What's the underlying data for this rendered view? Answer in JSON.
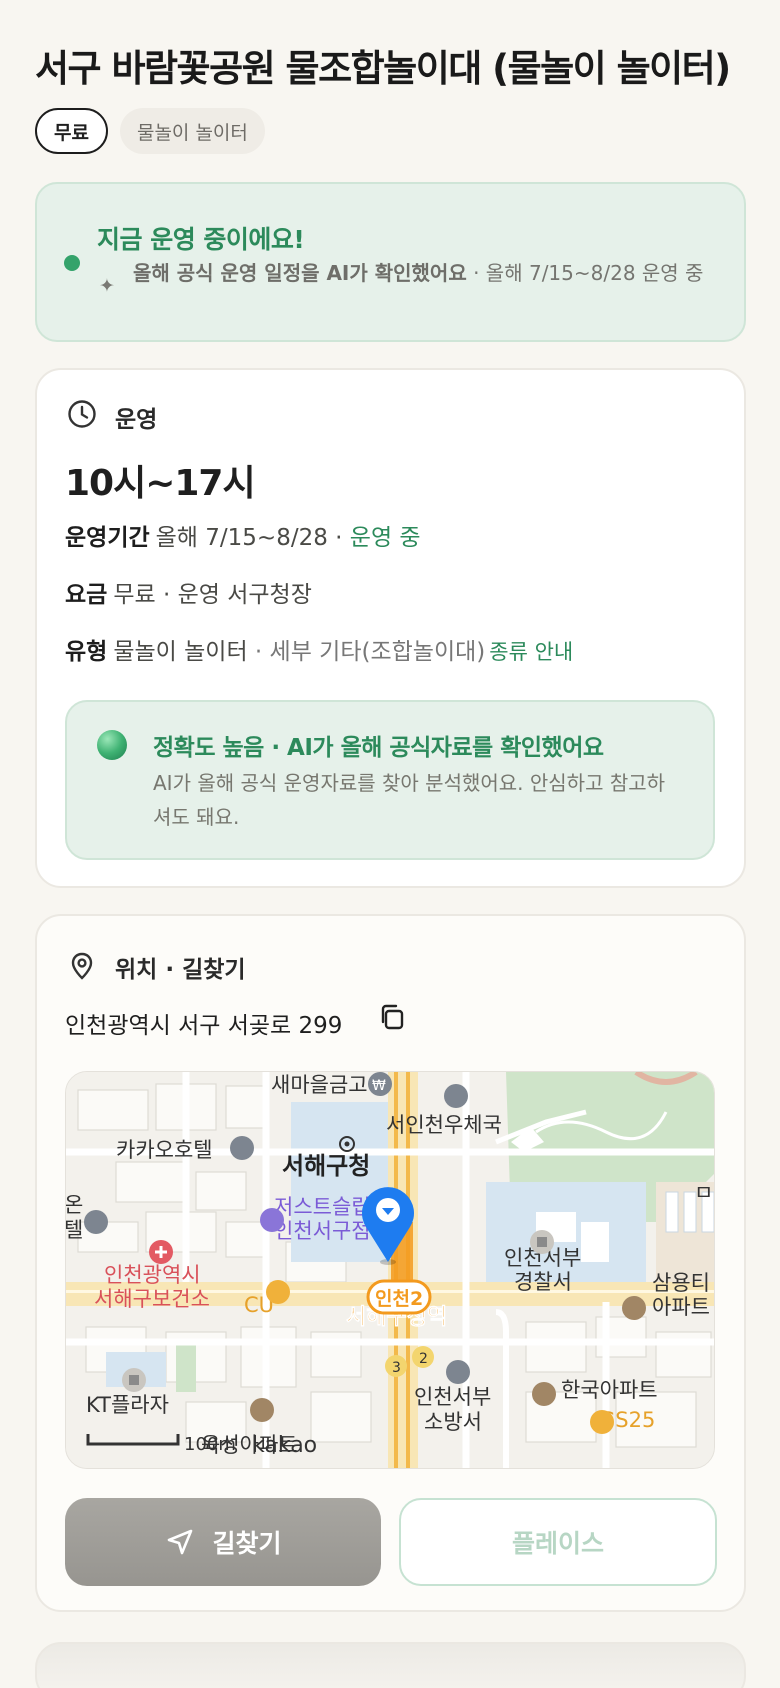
{
  "header": {
    "title": "서구 바람꽃공원 물조합놀이대 (물놀이 놀이터)",
    "chips": [
      "무료",
      "물놀이 놀이터"
    ]
  },
  "status": {
    "title": "지금 운영 중이에요!",
    "sub_bold": "올해 공식 운영 일정을 AI가 확인했어요",
    "sub_rest": " · 올해 7/15~8/28 운영 중"
  },
  "operation": {
    "section_title": "운영",
    "hours": "10시~17시",
    "period_label": "운영기간",
    "period_value": "올해 7/15~8/28 · ",
    "period_status": "운영 중",
    "fee_label": "요금",
    "fee_value": "무료 · 운영 서구청장",
    "type_label": "유형",
    "type_value": "물놀이 놀이터",
    "type_detail": " · 세부 기타(조합놀이대)",
    "type_guide": "종류 안내",
    "accuracy_title": "정확도 높음 · AI가 올해 공식자료를 확인했어요",
    "accuracy_desc": "AI가 올해 공식 운영자료를 찾아 분석했어요. 안심하고 참고하셔도 돼요."
  },
  "location": {
    "section_title": "위치 · 길찾기",
    "address": "인천광역시 서구 서곶로 299",
    "map_labels": {
      "bank": "새마을금고",
      "post": "서인천우체국",
      "hotel1": "카카오호텔",
      "gu_office": "서해구청",
      "hotel2a": "저스트슬립호텔",
      "hotel2b": "인천서구점",
      "health_a": "인천광역시",
      "health_b": "서해구보건소",
      "cu": "CU",
      "station_badge": "인천2",
      "station": "서해구청역",
      "exit3": "3",
      "exit2": "2",
      "police_a": "인천서부",
      "police_b": "경찰서",
      "apt1_a": "삼용티",
      "apt1_b": "아파트",
      "fire_a": "인천서부",
      "fire_b": "소방서",
      "apt2": "한국아파트",
      "gs": "GS25",
      "kt": "KT플라자",
      "apt3": "육성아파트",
      "scale": "100m",
      "kakao": "kakao",
      "edge_left_a": "온",
      "edge_left_b": "텔",
      "edge_right": "ㅁ"
    },
    "route_label": "길찾기",
    "place_label": "플레이스"
  },
  "colors": {
    "accent_green": "#2c8a5b",
    "pin_blue": "#1e7cf0",
    "station_orange": "#f39a1e"
  }
}
